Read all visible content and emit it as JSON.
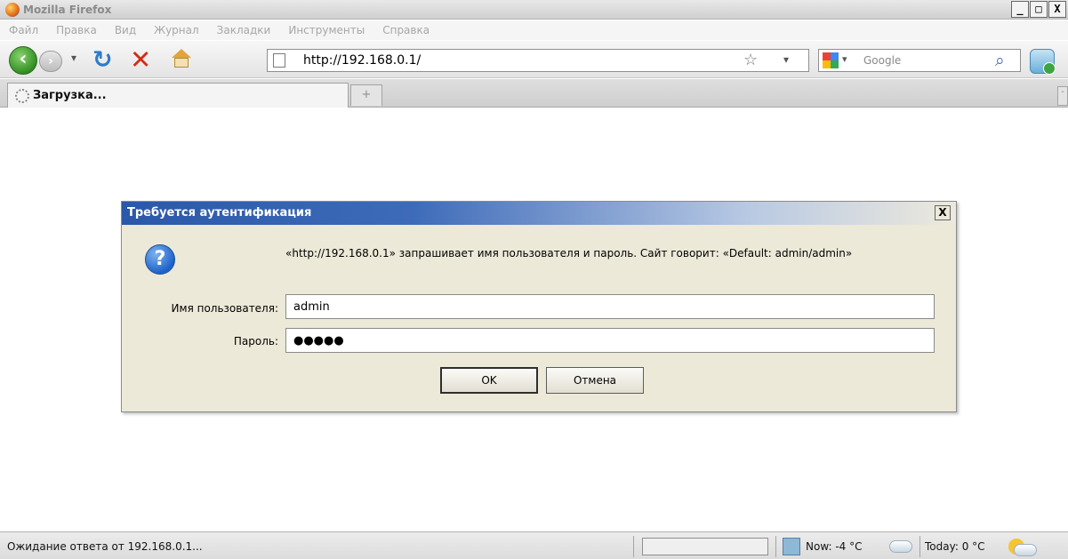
{
  "window": {
    "title": "Mozilla Firefox",
    "min_label": "_",
    "max_label": "□",
    "close_label": "X"
  },
  "menu": [
    "Файл",
    "Правка",
    "Вид",
    "Журнал",
    "Закладки",
    "Инструменты",
    "Справка"
  ],
  "toolbar": {
    "url": "http://192.168.0.1/",
    "search_placeholder": "Google"
  },
  "tabs": [
    {
      "label": "Загрузка..."
    }
  ],
  "dialog": {
    "title": "Требуется аутентификация",
    "close_label": "X",
    "message": "«http://192.168.0.1» запрашивает имя пользователя и пароль. Сайт говорит: «Default: admin/admin»",
    "username_label": "Имя пользователя:",
    "username_value": "admin",
    "password_label": "Пароль:",
    "password_value": "●●●●●",
    "ok_label": "OK",
    "cancel_label": "Отмена"
  },
  "status": {
    "text": "Ожидание ответа от 192.168.0.1...",
    "weather_now": "Now: -4 °C",
    "weather_today": "Today: 0 °C"
  },
  "colors": {
    "dialog_title": "#2b58a8",
    "dialog_bg": "#ece9d8"
  }
}
